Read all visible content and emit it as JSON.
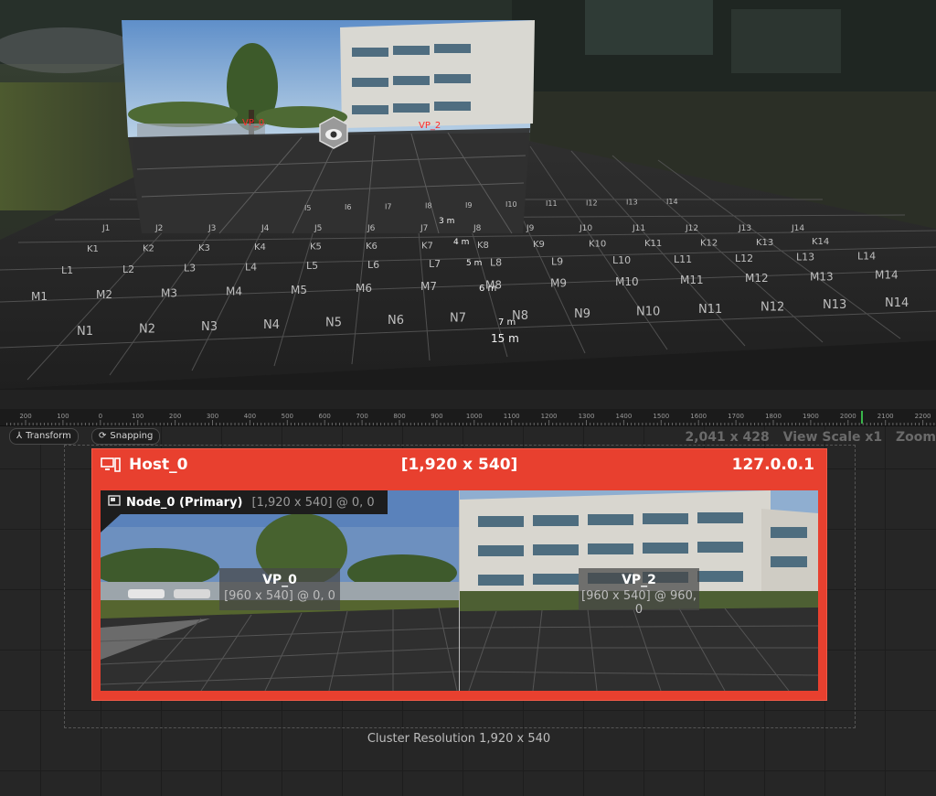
{
  "scene": {
    "grid_rows": [
      {
        "row": "J",
        "cells": [
          "J1",
          "J2",
          "J3",
          "J4",
          "J5",
          "J6",
          "J7",
          "J8",
          "J9",
          "J10",
          "J11",
          "J12",
          "J13",
          "J14"
        ]
      },
      {
        "row": "K",
        "cells": [
          "K1",
          "K2",
          "K3",
          "K4",
          "K5",
          "K6",
          "K7",
          "K8",
          "K9",
          "K10",
          "K11",
          "K12",
          "K13",
          "K14"
        ]
      },
      {
        "row": "L",
        "cells": [
          "L1",
          "L2",
          "L3",
          "L4",
          "L5",
          "L6",
          "L7",
          "L8",
          "L9",
          "L10",
          "L11",
          "L12",
          "L13",
          "L14"
        ]
      },
      {
        "row": "M",
        "cells": [
          "M1",
          "M2",
          "M3",
          "M4",
          "M5",
          "M6",
          "M7",
          "M8",
          "M9",
          "M10",
          "M11",
          "M12",
          "M13",
          "M14"
        ]
      },
      {
        "row": "N",
        "cells": [
          "N1",
          "N2",
          "N3",
          "N4",
          "N5",
          "N6",
          "N7",
          "N8",
          "N9",
          "N10",
          "N11",
          "N12",
          "N13",
          "N14"
        ]
      }
    ],
    "upper_row_cells": [
      "I5",
      "I6",
      "I7",
      "I8",
      "I9",
      "I10",
      "I11",
      "I12",
      "I13",
      "I14"
    ],
    "distance_labels": [
      "3 m",
      "4 m",
      "5 m",
      "6 m",
      "7 m",
      "15 m"
    ],
    "viewport_markers": [
      "VP_0",
      "VP_2"
    ],
    "camera_icon": "camera-eye-icon"
  },
  "ruler": {
    "ticks": [
      "200",
      "100",
      "0",
      "100",
      "200",
      "300",
      "400",
      "500",
      "600",
      "700",
      "800",
      "900",
      "1000",
      "1100",
      "1200",
      "1300",
      "1400",
      "1500",
      "1600",
      "1700",
      "1800",
      "1900",
      "2000",
      "2100",
      "2200"
    ]
  },
  "toolbar": {
    "transform_label": "Transform",
    "transform_icon": "transform-axes-icon",
    "snapping_label": "Snapping",
    "snapping_icon": "magnet-icon"
  },
  "view_info": {
    "size": "2,041 x 428",
    "scale": "View Scale x1",
    "zoom": "Zoom"
  },
  "host": {
    "name": "Host_0",
    "resolution": "[1,920 x 540]",
    "ip": "127.0.0.1",
    "color": "#e8402f",
    "icon": "computer-host-icon"
  },
  "node": {
    "name": "Node_0 (Primary)",
    "info": "[1,920 x 540] @ 0, 0",
    "icon": "display-node-icon"
  },
  "viewports": [
    {
      "name": "VP_0",
      "info": "[960 x 540] @ 0, 0"
    },
    {
      "name": "VP_2",
      "info": "[960 x 540] @ 960, 0"
    }
  ],
  "cluster": {
    "resolution": "Cluster Resolution 1,920 x 540"
  }
}
